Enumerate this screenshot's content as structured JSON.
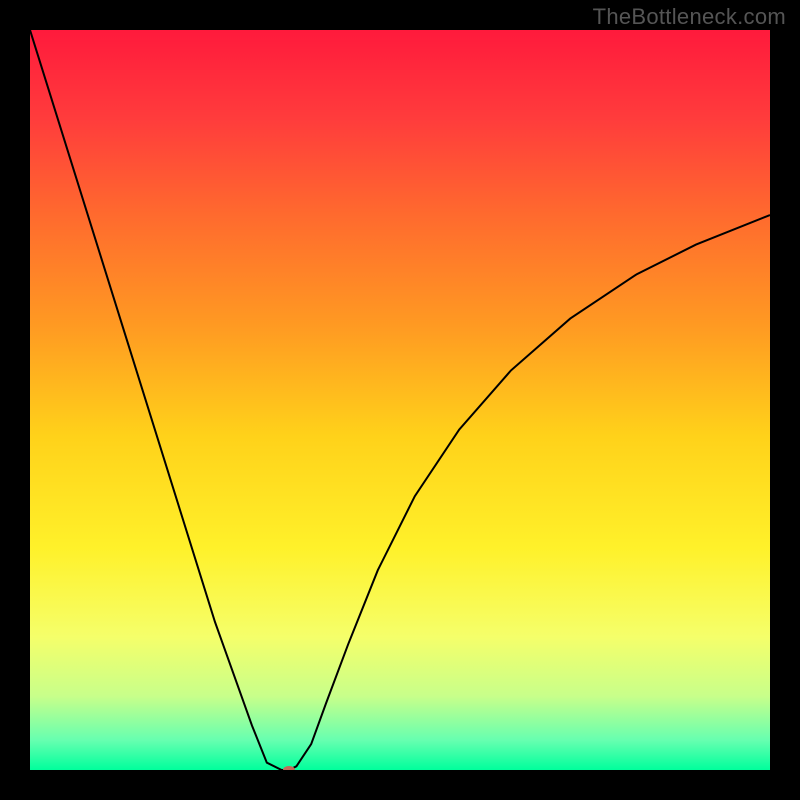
{
  "watermark": "TheBottleneck.com",
  "chart_data": {
    "type": "line",
    "title": "",
    "xlabel": "",
    "ylabel": "",
    "xlim": [
      0,
      100
    ],
    "ylim": [
      0,
      100
    ],
    "grid": false,
    "legend": false,
    "series": [
      {
        "name": "curve",
        "x": [
          0,
          5,
          10,
          15,
          20,
          25,
          30,
          32,
          34,
          35,
          36,
          38,
          40,
          43,
          47,
          52,
          58,
          65,
          73,
          82,
          90,
          100
        ],
        "y": [
          100,
          84,
          68,
          52,
          36,
          20,
          6,
          1,
          0,
          0,
          0.5,
          3.5,
          9,
          17,
          27,
          37,
          46,
          54,
          61,
          67,
          71,
          75
        ],
        "stroke": "#000000",
        "stroke_width": 2
      }
    ],
    "marker": {
      "x": 35,
      "y": 0,
      "rx": 6,
      "ry": 4,
      "fill": "#c26a5a"
    },
    "background_gradient": {
      "stops": [
        {
          "offset": 0.0,
          "color": "#ff1a3c"
        },
        {
          "offset": 0.12,
          "color": "#ff3c3c"
        },
        {
          "offset": 0.25,
          "color": "#ff6a2e"
        },
        {
          "offset": 0.4,
          "color": "#ff9a22"
        },
        {
          "offset": 0.55,
          "color": "#ffd21a"
        },
        {
          "offset": 0.7,
          "color": "#fff12a"
        },
        {
          "offset": 0.82,
          "color": "#f5ff6a"
        },
        {
          "offset": 0.9,
          "color": "#c8ff8a"
        },
        {
          "offset": 0.96,
          "color": "#66ffb0"
        },
        {
          "offset": 1.0,
          "color": "#00ff9c"
        }
      ]
    }
  }
}
